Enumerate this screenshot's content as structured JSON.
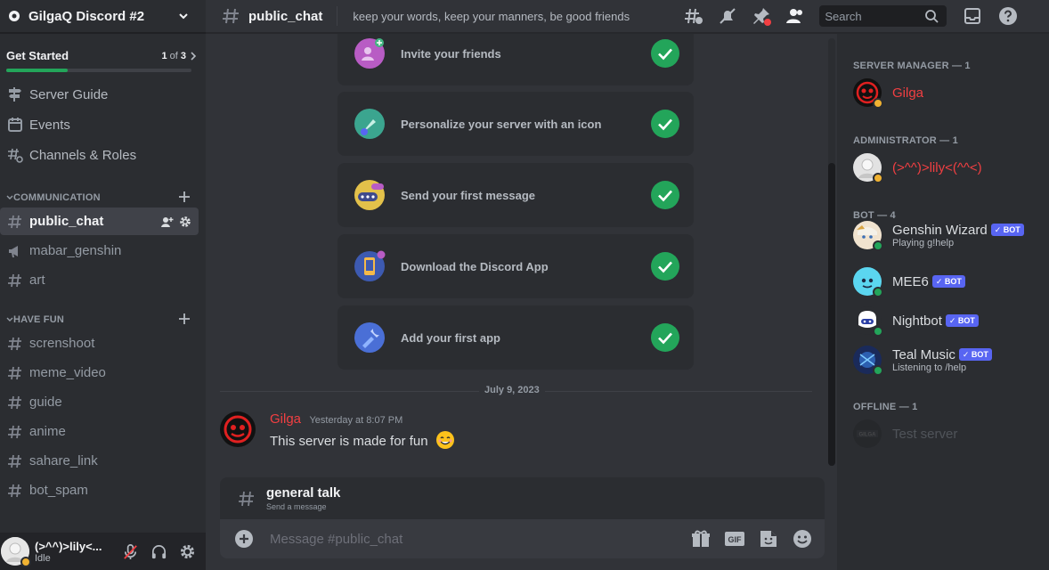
{
  "server": {
    "name": "GilgaQ Discord #2"
  },
  "get_started": {
    "label": "Get Started",
    "progress_current": "1",
    "progress_of": " of ",
    "progress_total": "3",
    "progress_fraction": 0.33
  },
  "nav": [
    {
      "label": "Server Guide",
      "icon": "signpost-icon"
    },
    {
      "label": "Events",
      "icon": "calendar-icon"
    },
    {
      "label": "Channels & Roles",
      "icon": "channels-roles-icon"
    }
  ],
  "categories": [
    {
      "name": "COMMUNICATION",
      "channels": [
        {
          "name": "public_chat",
          "active": true
        },
        {
          "name": "mabar_genshin",
          "icon": "announcement-icon"
        },
        {
          "name": "art"
        }
      ]
    },
    {
      "name": "HAVE FUN",
      "channels": [
        {
          "name": "screnshoot"
        },
        {
          "name": "meme_video"
        },
        {
          "name": "guide"
        },
        {
          "name": "anime"
        },
        {
          "name": "sahare_link"
        },
        {
          "name": "bot_spam"
        }
      ]
    }
  ],
  "user": {
    "name": "(>^^)>lily<...",
    "status": "Idle"
  },
  "channel": {
    "name": "public_chat",
    "topic": "keep your words, keep your manners, be good friends"
  },
  "search": {
    "placeholder": "Search"
  },
  "setup_tasks": [
    {
      "label": "Invite your friends",
      "icon": "invite-icon"
    },
    {
      "label": "Personalize your server with an icon",
      "icon": "brush-icon"
    },
    {
      "label": "Send your first message",
      "icon": "message-icon"
    },
    {
      "label": "Download the Discord App",
      "icon": "download-app-icon"
    },
    {
      "label": "Add your first app",
      "icon": "app-icon"
    }
  ],
  "date_divider": "July 9, 2023",
  "message": {
    "author": "Gilga",
    "time": "Yesterday at 8:07 PM",
    "text": "This server is made for fun"
  },
  "thread": {
    "name": "general talk",
    "sub": "Send a message"
  },
  "composer": {
    "placeholder": "Message #public_chat"
  },
  "member_groups": [
    {
      "title": "SERVER MANAGER — 1",
      "members": [
        {
          "name": "Gilga",
          "color": "#f23f42",
          "status": "idle"
        }
      ]
    },
    {
      "title": "ADMINISTRATOR — 1",
      "members": [
        {
          "name": "(>^^)>lily<(^^<)",
          "color": "#f23f42",
          "status": "idle"
        }
      ]
    },
    {
      "title": "BOT — 4",
      "members": [
        {
          "name": "Genshin Wizard",
          "bot": "BOT",
          "activity": "Playing g!help",
          "status": "online"
        },
        {
          "name": "MEE6",
          "bot": "BOT",
          "status": "online"
        },
        {
          "name": "Nightbot",
          "bot": "BOT",
          "status": "online"
        },
        {
          "name": "Teal Music",
          "bot": "BOT",
          "activity": "Listening to /help",
          "status": "online"
        }
      ]
    },
    {
      "title": "OFFLINE — 1",
      "members": [
        {
          "name": "Test server",
          "status": "offline"
        }
      ]
    }
  ],
  "colors": {
    "accent": "#5865f2",
    "online": "#23a55a",
    "idle": "#f0b232",
    "danger": "#f23f42"
  }
}
